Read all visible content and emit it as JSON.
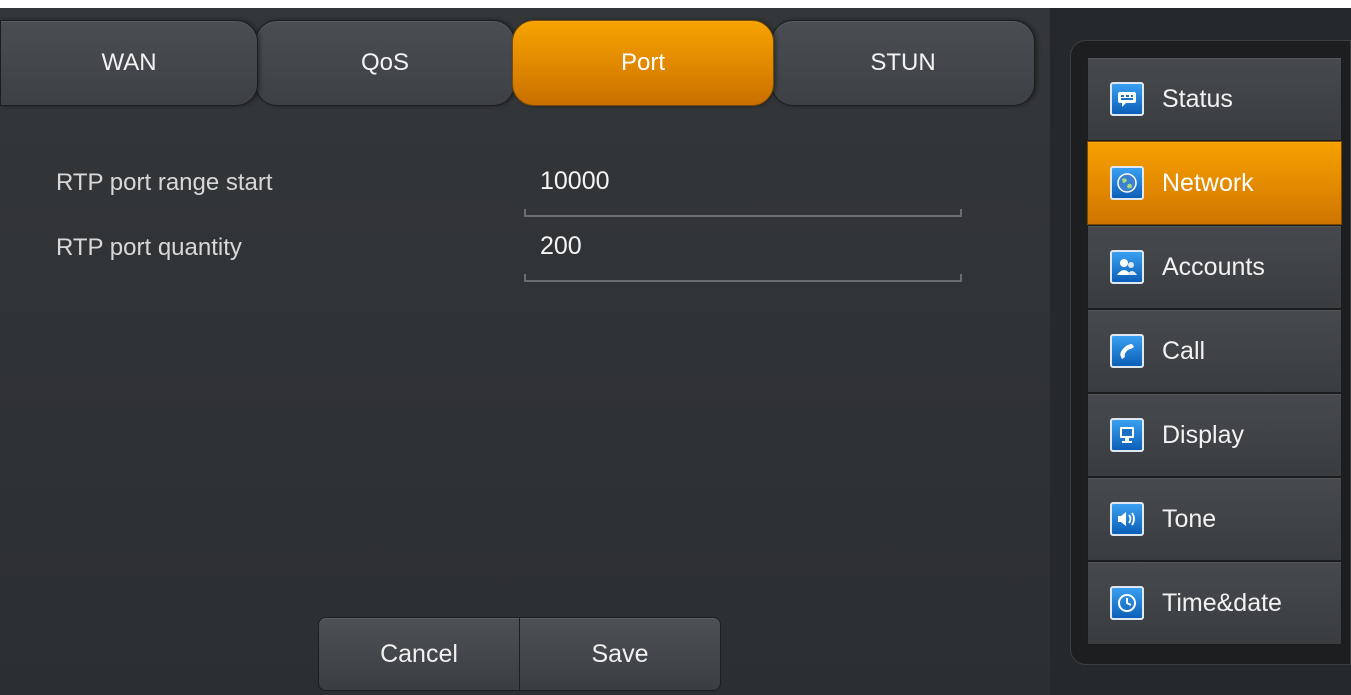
{
  "tabs": [
    {
      "label": "WAN"
    },
    {
      "label": "QoS"
    },
    {
      "label": "Port",
      "active": true
    },
    {
      "label": "STUN"
    }
  ],
  "form": {
    "rtp_start": {
      "label": "RTP port range start",
      "value": "10000"
    },
    "rtp_quantity": {
      "label": "RTP port quantity",
      "value": "200"
    }
  },
  "buttons": {
    "cancel": "Cancel",
    "save": "Save"
  },
  "sidebar": {
    "items": [
      {
        "label": "Status",
        "icon": "status-icon"
      },
      {
        "label": "Network",
        "icon": "globe-icon",
        "active": true
      },
      {
        "label": "Accounts",
        "icon": "accounts-icon"
      },
      {
        "label": "Call",
        "icon": "phone-icon"
      },
      {
        "label": "Display",
        "icon": "monitor-icon"
      },
      {
        "label": "Tone",
        "icon": "speaker-icon"
      },
      {
        "label": "Time&date",
        "icon": "clock-icon"
      }
    ]
  },
  "colors": {
    "accent": "#e88e00",
    "background": "#2e3134"
  }
}
